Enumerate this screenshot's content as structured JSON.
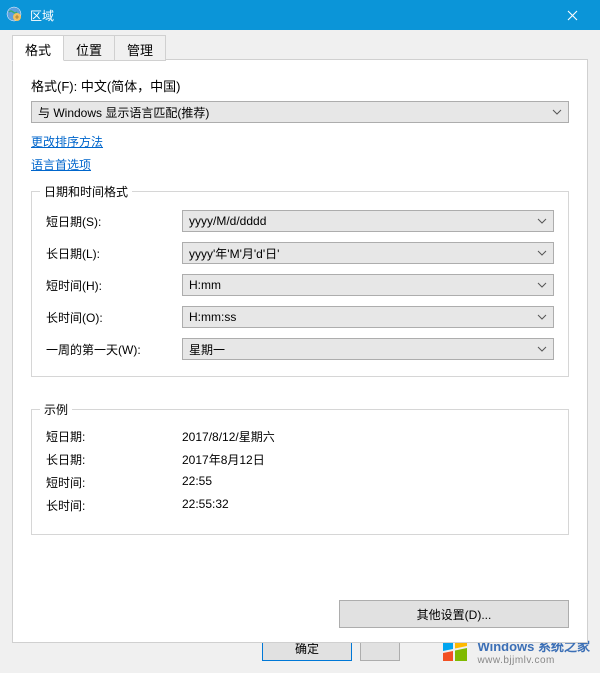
{
  "titlebar": {
    "title": "区域",
    "close_icon": "close"
  },
  "tabs": {
    "items": [
      {
        "label": "格式",
        "active": true
      },
      {
        "label": "位置",
        "active": false
      },
      {
        "label": "管理",
        "active": false
      }
    ]
  },
  "format": {
    "label": "格式(F): 中文(简体，中国)",
    "selected": "与 Windows 显示语言匹配(推荐)"
  },
  "links": {
    "change_sort": "更改排序方法",
    "lang_prefs": "语言首选项"
  },
  "datetime_group": {
    "legend": "日期和时间格式",
    "rows": [
      {
        "label": "短日期(S):",
        "value": "yyyy/M/d/dddd"
      },
      {
        "label": "长日期(L):",
        "value": "yyyy'年'M'月'd'日'"
      },
      {
        "label": "短时间(H):",
        "value": "H:mm"
      },
      {
        "label": "长时间(O):",
        "value": "H:mm:ss"
      },
      {
        "label": "一周的第一天(W):",
        "value": "星期一"
      }
    ]
  },
  "example_group": {
    "legend": "示例",
    "rows": [
      {
        "label": "短日期:",
        "value": "2017/8/12/星期六"
      },
      {
        "label": "长日期:",
        "value": "2017年8月12日"
      },
      {
        "label": "短时间:",
        "value": "22:55"
      },
      {
        "label": "长时间:",
        "value": "22:55:32"
      }
    ]
  },
  "buttons": {
    "other_settings": "其他设置(D)...",
    "ok": "确定"
  },
  "watermark": {
    "text": "Windows 系统之家",
    "sub": "www.bjjmlv.com"
  }
}
